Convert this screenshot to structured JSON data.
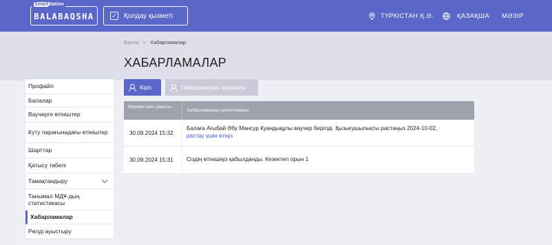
{
  "header": {
    "logo_small": "SmartNation",
    "logo_highlight": "Smart",
    "logo_rest": "Nation",
    "logo_main": "BALABAQSHA",
    "service_button": "Қолдау қызметі",
    "location": "ТҮРКІСТАН Қ.Ә.",
    "language": "ҚАЗАҚША",
    "menu": "МӘЗІР",
    "colors": {
      "primary": "#5a66c8",
      "band": "#dde0ea"
    }
  },
  "breadcrumb": {
    "home": "Басты",
    "separator": ">",
    "current": "Хабарламалар"
  },
  "page_title": "ХАБАРЛАМАЛАР",
  "sidebar": {
    "items": [
      {
        "label": "Профайл"
      },
      {
        "label": "Балалар"
      },
      {
        "label": "Ваучерге өтініштер"
      },
      {
        "label": "Күту парағынадағы өтініштер"
      },
      {
        "label": "Шарттар"
      },
      {
        "label": "Қатысу табелі"
      },
      {
        "label": "Тамақтандыру"
      },
      {
        "label": "Танымал МДҰ-дың статистикасы"
      },
      {
        "label": "Хабарламалар",
        "active": true
      },
      {
        "label": "Рөлді ауыстыру"
      }
    ]
  },
  "tabs": {
    "inbox": "Кіріс",
    "user_log": "Пайдаланушы журналы",
    "icon": "person-icon"
  },
  "table": {
    "headers": {
      "date": "Мерзімі мен уақыты",
      "description": "Хабарламаның сипаттамасы"
    },
    "rows": [
      {
        "date": "30.09.2024 15:32",
        "text": "Балаға Ағыбай Әбу Мансур Куандықұлы ваучер берілді. Қызығушылықты растаңыз 2024-10-02,",
        "link": "растау үшін өтіңіз"
      },
      {
        "date": "30.09.2024 15:31",
        "text": "Сіздің өтінішіңіз қабылданды. Кезектегі орын 1",
        "link": ""
      }
    ]
  }
}
